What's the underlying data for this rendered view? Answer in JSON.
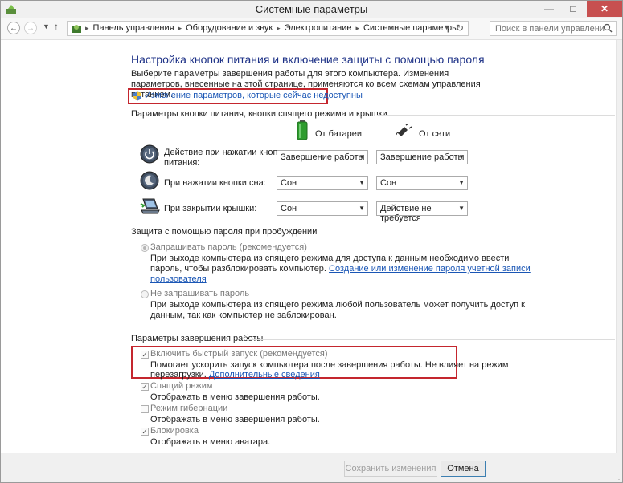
{
  "window": {
    "title": "Системные параметры"
  },
  "nav": {
    "breadcrumbs": [
      "Панель управления",
      "Оборудование и звук",
      "Электропитание",
      "Системные параметры"
    ],
    "search_placeholder": "Поиск в панели управления"
  },
  "page": {
    "heading": "Настройка кнопок питания и включение защиты с помощью пароля",
    "description": "Выберите параметры завершения работы для этого компьютера. Изменения параметров, внесенные на этой странице, применяются ко всем схемам управления питанием.",
    "change_link": "Изменение параметров, которые сейчас недоступны"
  },
  "power_buttons": {
    "section_title": "Параметры кнопки питания, кнопки спящего режима и крышки",
    "col_battery": "От батареи",
    "col_ac": "От сети",
    "rows": [
      {
        "label_line1": "Действие при нажатии кнопки",
        "label_line2": "питания:",
        "battery": "Завершение работы",
        "ac": "Завершение работы"
      },
      {
        "label_line1": "При нажатии кнопки сна:",
        "label_line2": "",
        "battery": "Сон",
        "ac": "Сон"
      },
      {
        "label_line1": "При закрытии крышки:",
        "label_line2": "",
        "battery": "Сон",
        "ac": "Действие не требуется"
      }
    ]
  },
  "password": {
    "section_title": "Защита с помощью пароля при пробуждении",
    "opt1_label": "Запрашивать пароль (рекомендуется)",
    "opt1_desc_line1": "При выходе компьютера из спящего режима для доступа к данным необходимо ввести",
    "opt1_desc_line2_text": "пароль, чтобы разблокировать компьютер. ",
    "opt1_link_part1": "Создание или изменение пароля учетной записи",
    "opt1_link_part2": "пользователя",
    "opt2_label": "Не запрашивать пароль",
    "opt2_desc_line1": "При выходе компьютера из спящего режима любой пользователь может получить доступ к",
    "opt2_desc_line2": "данным, так как компьютер не заблокирован."
  },
  "shutdown": {
    "section_title": "Параметры завершения работы",
    "items": [
      {
        "label": "Включить быстрый запуск (рекомендуется)",
        "desc_line1": "Помогает ускорить запуск компьютера после завершения работы. Не влияет на режим",
        "desc_line2": "перезагрузки. ",
        "link": "Дополнительные сведения",
        "checked": true
      },
      {
        "label": "Спящий режим",
        "desc_line1": "Отображать в меню завершения работы.",
        "checked": true
      },
      {
        "label": "Режим гибернации",
        "desc_line1": "Отображать в меню завершения работы.",
        "checked": false
      },
      {
        "label": "Блокировка",
        "desc_line1": "Отображать в меню аватара.",
        "checked": true
      }
    ]
  },
  "footer": {
    "save_label": "Сохранить изменения",
    "cancel_label": "Отмена"
  }
}
